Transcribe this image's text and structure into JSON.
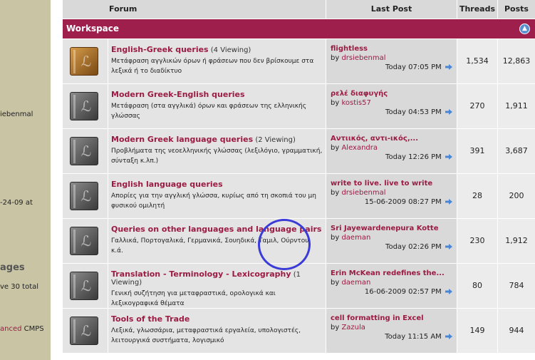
{
  "sidebar": {
    "user_fragment": "iebenmal",
    "date_fragment": "-24-09 at",
    "heading_fragment": "ages",
    "total_fragment": "ve 30 total",
    "link_fragment": "anced",
    "link_suffix": "CMPS"
  },
  "header": {
    "forum": "Forum",
    "last_post": "Last Post",
    "threads": "Threads",
    "posts": "Posts"
  },
  "category": {
    "name": "Workspace",
    "collapse_icon": "collapse-up-icon",
    "color": "#9e1e4c"
  },
  "forums": [
    {
      "title": "English-Greek queries",
      "viewing": "(4 Viewing)",
      "description": "Μετάφραση αγγλικών όρων ή φράσεων που δεν βρίσκουμε στα λεξικά ή το διαδίκτυο",
      "icon": "forum-new-posts-icon",
      "last_title": "flightless",
      "last_by": "by",
      "last_user": "drsiebenmal",
      "last_time": "Today 07:05 PM",
      "threads": "1,534",
      "posts": "12,863"
    },
    {
      "title": "Modern Greek-English queries",
      "viewing": "",
      "description": "Μετάφραση (στα αγγλικά) όρων και φράσεων της ελληνικής γλώσσας",
      "icon": "forum-icon",
      "last_title": "ρελέ διαφυγής",
      "last_by": "by",
      "last_user": "kostis57",
      "last_time": "Today 04:53 PM",
      "threads": "270",
      "posts": "1,911"
    },
    {
      "title": "Modern Greek language queries",
      "viewing": "(2 Viewing)",
      "description": "Προβλήματα της νεοελληνικής γλώσσας (λεξιλόγιο, γραμματική, σύνταξη κ.λπ.)",
      "icon": "forum-icon",
      "last_title": "Αντιικός, αντι-ικός,...",
      "last_by": "by",
      "last_user": "Alexandra",
      "last_time": "Today 12:26 PM",
      "threads": "391",
      "posts": "3,687"
    },
    {
      "title": "English language queries",
      "viewing": "",
      "description": "Απορίες για την αγγλική γλώσσα, κυρίως από τη σκοπιά του μη φυσικού ομιλητή",
      "icon": "forum-icon",
      "last_title": "write to live. live to write",
      "last_by": "by",
      "last_user": "drsiebenmal",
      "last_time": "15-06-2009 08:27 PM",
      "threads": "28",
      "posts": "200"
    },
    {
      "title": "Queries on other languages and language pairs",
      "viewing": "",
      "description": "Γαλλικά, Πορτογαλικά, Γερμανικά, Σουηδικά, Ταμιλ, Ούρντου κ.ά.",
      "icon": "forum-icon",
      "last_title": "Sri Jayewardenepura Kotte",
      "last_by": "by",
      "last_user": "daeman",
      "last_time": "Today 02:26 PM",
      "threads": "230",
      "posts": "1,912"
    },
    {
      "title": "Translation - Terminology - Lexicography",
      "viewing": "(1 Viewing)",
      "description": "Γενική συζήτηση για μεταφραστικά, ορολογικά και λεξικογραφικά θέματα",
      "icon": "forum-icon",
      "last_title": "Erin McKean redefines the...",
      "last_by": "by",
      "last_user": "daeman",
      "last_time": "16-06-2009 02:57 PM",
      "threads": "80",
      "posts": "784"
    },
    {
      "title": "Tools of the Trade",
      "viewing": "",
      "description": "Λεξικά, γλωσσάρια, μεταφραστικά εργαλεία, υπολογιστές, λειτουργικά συστήματα, λογισμικό",
      "icon": "forum-icon",
      "last_title": "cell formatting in Excel",
      "last_by": "by",
      "last_user": "Zazula",
      "last_time": "Today 11:15 AM",
      "threads": "149",
      "posts": "944"
    }
  ]
}
